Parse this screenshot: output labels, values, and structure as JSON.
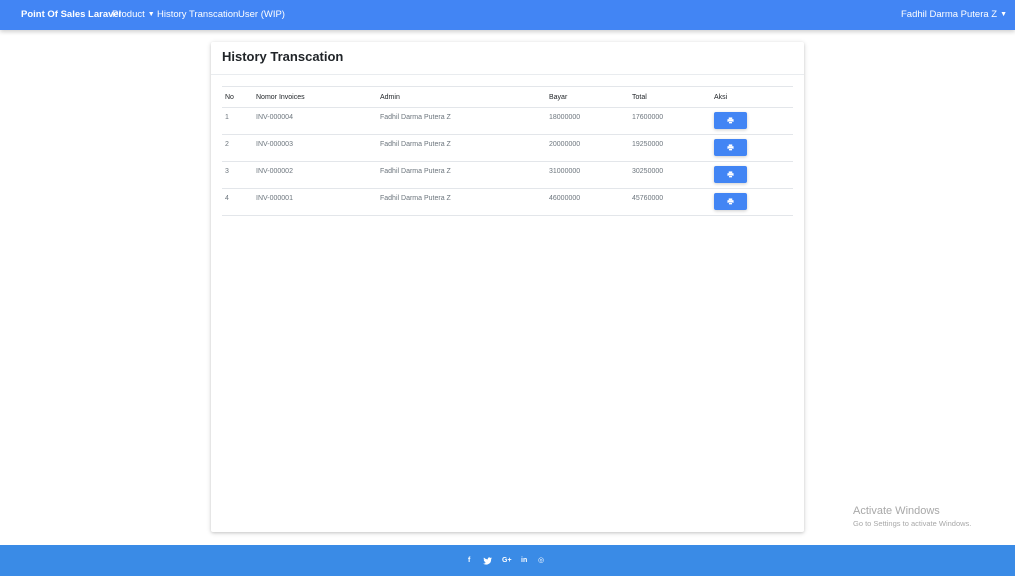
{
  "navbar": {
    "brand": "Point Of Sales Laravel",
    "links": [
      "Product",
      "History Transcation",
      "User (WIP)"
    ],
    "user": "Fadhil Darma Putera Z"
  },
  "card": {
    "title": "History Transcation"
  },
  "table": {
    "headers": [
      "No",
      "Nomor Invoices",
      "Admin",
      "Bayar",
      "Total",
      "Aksi"
    ],
    "rows": [
      {
        "no": "1",
        "invoice": "INV-000004",
        "admin": "Fadhil Darma Putera Z",
        "bayar": "18000000",
        "total": "17600000"
      },
      {
        "no": "2",
        "invoice": "INV-000003",
        "admin": "Fadhil Darma Putera Z",
        "bayar": "20000000",
        "total": "19250000"
      },
      {
        "no": "3",
        "invoice": "INV-000002",
        "admin": "Fadhil Darma Putera Z",
        "bayar": "31000000",
        "total": "30250000"
      },
      {
        "no": "4",
        "invoice": "INV-000001",
        "admin": "Fadhil Darma Putera Z",
        "bayar": "46000000",
        "total": "45760000"
      }
    ],
    "action_icon": "print-icon"
  },
  "footer": {
    "icons": [
      "facebook-icon",
      "twitter-icon",
      "google-plus-icon",
      "linkedin-icon",
      "dribbble-icon"
    ],
    "glyphs": [
      "f",
      "🐦",
      "G+",
      "in",
      "◎"
    ]
  },
  "watermark": {
    "title": "Activate Windows",
    "subtitle": "Go to Settings to activate Windows."
  },
  "colors": {
    "primary": "#4285f4",
    "footer": "#3a8be6"
  }
}
